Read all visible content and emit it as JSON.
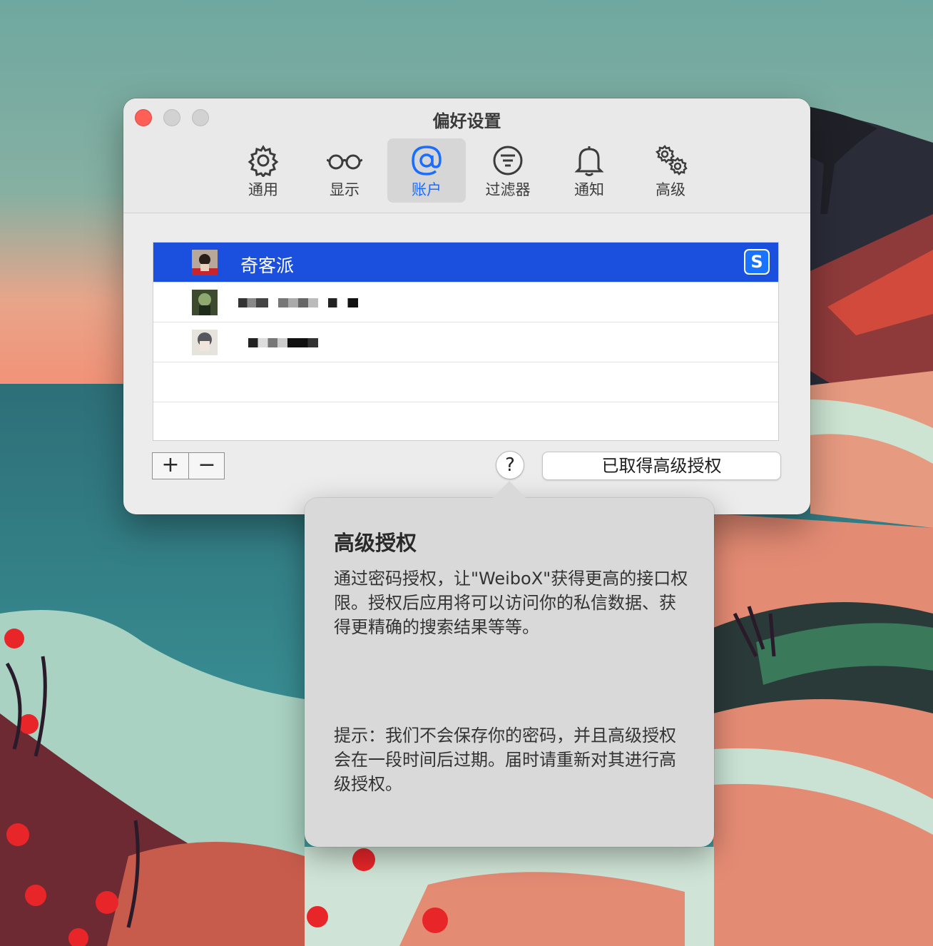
{
  "window": {
    "title": "偏好设置"
  },
  "toolbar": {
    "items": [
      {
        "label": "通用",
        "icon": "gear-icon"
      },
      {
        "label": "显示",
        "icon": "glasses-icon"
      },
      {
        "label": "账户",
        "icon": "at-icon",
        "active": true
      },
      {
        "label": "过滤器",
        "icon": "filter-icon"
      },
      {
        "label": "通知",
        "icon": "bell-icon"
      },
      {
        "label": "高级",
        "icon": "gears-icon"
      }
    ]
  },
  "accounts": {
    "rows": [
      {
        "name": "奇客派",
        "selected": true,
        "badge": "S"
      },
      {
        "name": "",
        "redacted": true
      },
      {
        "name": "",
        "redacted": true
      }
    ]
  },
  "controls": {
    "add_label": "+",
    "remove_label": "−",
    "help_label": "?",
    "auth_button_label": "已取得高级授权"
  },
  "popover": {
    "title": "高级授权",
    "body": "通过密码授权，让\"WeiboX\"获得更高的接口权限。授权后应用将可以访问你的私信数据、获得更精确的搜索结果等等。",
    "tip": "提示：我们不会保存你的密码，并且高级授权会在一段时间后过期。届时请重新对其进行高级授权。"
  },
  "colors": {
    "accent": "#1a6dff",
    "selection": "#1b4fde",
    "close": "#fe5f57"
  }
}
